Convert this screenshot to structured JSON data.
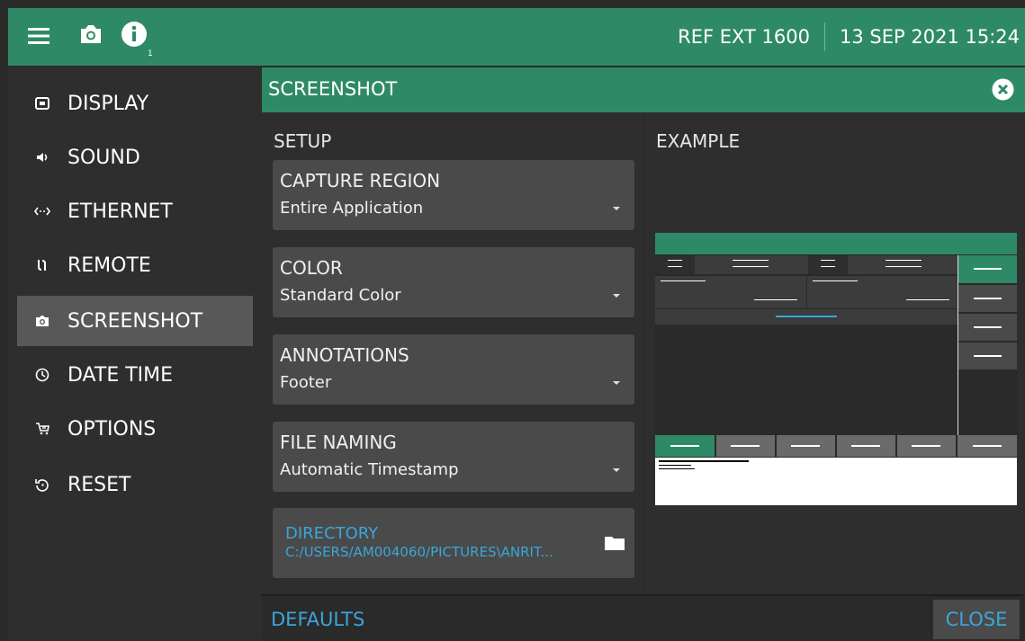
{
  "header": {
    "badge": "1",
    "ref_label": "REF EXT 1600",
    "datetime": "13 SEP 2021 15:24"
  },
  "sidebar": {
    "items": [
      {
        "label": "DISPLAY",
        "icon": "display-icon"
      },
      {
        "label": "SOUND",
        "icon": "speaker-icon"
      },
      {
        "label": "ETHERNET",
        "icon": "ethernet-icon"
      },
      {
        "label": "REMOTE",
        "icon": "remote-icon"
      },
      {
        "label": "SCREENSHOT",
        "icon": "camera-icon",
        "active": true
      },
      {
        "label": "DATE TIME",
        "icon": "clock-icon"
      },
      {
        "label": "OPTIONS",
        "icon": "cart-icon"
      },
      {
        "label": "RESET",
        "icon": "reset-icon"
      }
    ]
  },
  "panel": {
    "title": "SCREENSHOT",
    "setup_title": "SETUP",
    "example_title": "EXAMPLE",
    "fields": [
      {
        "label": "CAPTURE REGION",
        "value": "Entire Application"
      },
      {
        "label": "COLOR",
        "value": "Standard Color"
      },
      {
        "label": "ANNOTATIONS",
        "value": "Footer"
      },
      {
        "label": "FILE NAMING",
        "value": "Automatic Timestamp"
      }
    ],
    "directory": {
      "label": "DIRECTORY",
      "value": "C:/USERS/AM004060/PICTURES\\ANRIT..."
    },
    "defaults_label": "DEFAULTS",
    "close_label": "CLOSE"
  },
  "colors": {
    "accent": "#2e8a66",
    "link": "#3aa6d9",
    "panel": "#2e2e2e",
    "field": "#4a4a4a"
  }
}
